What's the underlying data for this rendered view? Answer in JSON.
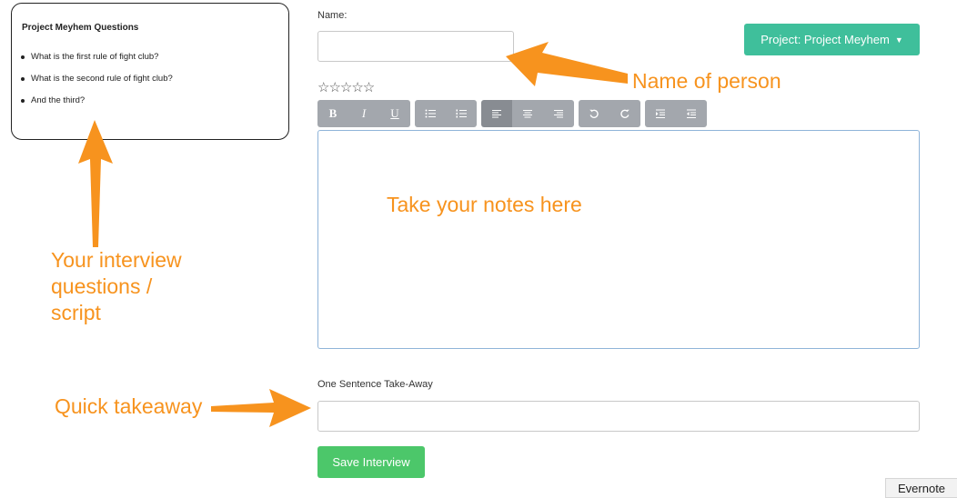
{
  "questions_panel": {
    "title": "Project Meyhem Questions",
    "items": [
      "What is the first rule of fight club?",
      "What is the second rule of fight club?",
      "And the third?"
    ]
  },
  "form": {
    "name_label": "Name:",
    "name_value": "",
    "project_button": "Project: Project Meyhem",
    "rating": "☆☆☆☆☆",
    "takeaway_label": "One Sentence Take-Away",
    "takeaway_value": "",
    "save_button": "Save Interview"
  },
  "toolbar": {
    "bold": "B",
    "italic": "I",
    "underline": "U"
  },
  "annotations": {
    "name": "Name of person",
    "notes": "Take your notes here",
    "questions_line1": "Your interview",
    "questions_line2": "questions /",
    "questions_line3": "script",
    "takeaway": "Quick takeaway"
  },
  "evernote_tab": "Evernote",
  "colors": {
    "accent_orange": "#f7931e",
    "project_button": "#3fbf9b",
    "save_button": "#4cc76a",
    "toolbar_button": "#a3a7ad"
  }
}
